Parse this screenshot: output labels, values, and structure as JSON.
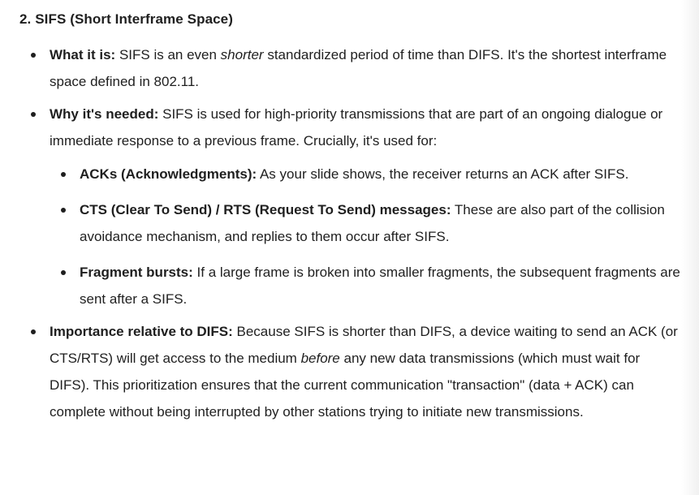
{
  "heading": "2. SIFS (Short Interframe Space)",
  "bullets": [
    {
      "label": "What it is:",
      "text_before": " SIFS is an even ",
      "italic": "shorter",
      "text_after": " standardized period of time than DIFS. It's the shortest interframe space defined in 802.11."
    },
    {
      "label": "Why it's needed:",
      "text": " SIFS is used for high-priority transmissions that are part of an ongoing dialogue or immediate response to a previous frame. Crucially, it's used for:",
      "sub": [
        {
          "label": "ACKs (Acknowledgments):",
          "text": " As your slide shows, the receiver returns an ACK after SIFS."
        },
        {
          "label": "CTS (Clear To Send) / RTS (Request To Send) messages:",
          "text": " These are also part of the collision avoidance mechanism, and replies to them occur after SIFS."
        },
        {
          "label": "Fragment bursts:",
          "text": " If a large frame is broken into smaller fragments, the subsequent fragments are sent after a SIFS."
        }
      ]
    },
    {
      "label": "Importance relative to DIFS:",
      "text_before": " Because SIFS is shorter than DIFS, a device waiting to send an ACK (or CTS/RTS) will get access to the medium ",
      "italic": "before",
      "text_after": " any new data transmissions (which must wait for DIFS). This prioritization ensures that the current communication \"transaction\" (data + ACK) can complete without being interrupted by other stations trying to initiate new transmissions."
    }
  ]
}
